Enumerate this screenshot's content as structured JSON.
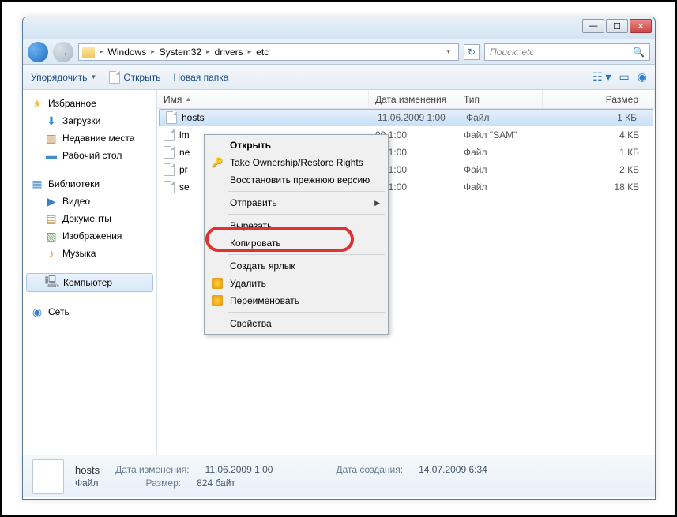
{
  "breadcrumb": [
    "Windows",
    "System32",
    "drivers",
    "etc"
  ],
  "search_placeholder": "Поиск: etc",
  "toolbar": {
    "organize": "Упорядочить",
    "open": "Открыть",
    "newfolder": "Новая папка"
  },
  "sidebar": {
    "favorites": "Избранное",
    "downloads": "Загрузки",
    "recent": "Недавние места",
    "desktop": "Рабочий стол",
    "libraries": "Библиотеки",
    "video": "Видео",
    "documents": "Документы",
    "pictures": "Изображения",
    "music": "Музыка",
    "computer": "Компьютер",
    "network": "Сеть"
  },
  "columns": {
    "name": "Имя",
    "date": "Дата изменения",
    "type": "Тип",
    "size": "Размер"
  },
  "files": [
    {
      "name": "hosts",
      "date": "11.06.2009 1:00",
      "type": "Файл",
      "size": "1 КБ"
    },
    {
      "name": "lm",
      "date": "09 1:00",
      "type": "Файл \"SAM\"",
      "size": "4 КБ"
    },
    {
      "name": "ne",
      "date": "09 1:00",
      "type": "Файл",
      "size": "1 КБ"
    },
    {
      "name": "pr",
      "date": "09 1:00",
      "type": "Файл",
      "size": "2 КБ"
    },
    {
      "name": "se",
      "date": "09 1:00",
      "type": "Файл",
      "size": "18 КБ"
    }
  ],
  "context": {
    "open": "Открыть",
    "takeownership": "Take Ownership/Restore Rights",
    "restore": "Восстановить прежнюю версию",
    "send": "Отправить",
    "cut": "Вырезать",
    "copy": "Копировать",
    "shortcut": "Создать ярлык",
    "delete": "Удалить",
    "rename": "Переименовать",
    "properties": "Свойства"
  },
  "status": {
    "fname": "hosts",
    "date_lbl": "Дата изменения:",
    "date_val": "11.06.2009 1:00",
    "created_lbl": "Дата создания:",
    "created_val": "14.07.2009 6:34",
    "type_lbl": "",
    "type_val": "Файл",
    "size_lbl": "Размер:",
    "size_val": "824 байт"
  }
}
